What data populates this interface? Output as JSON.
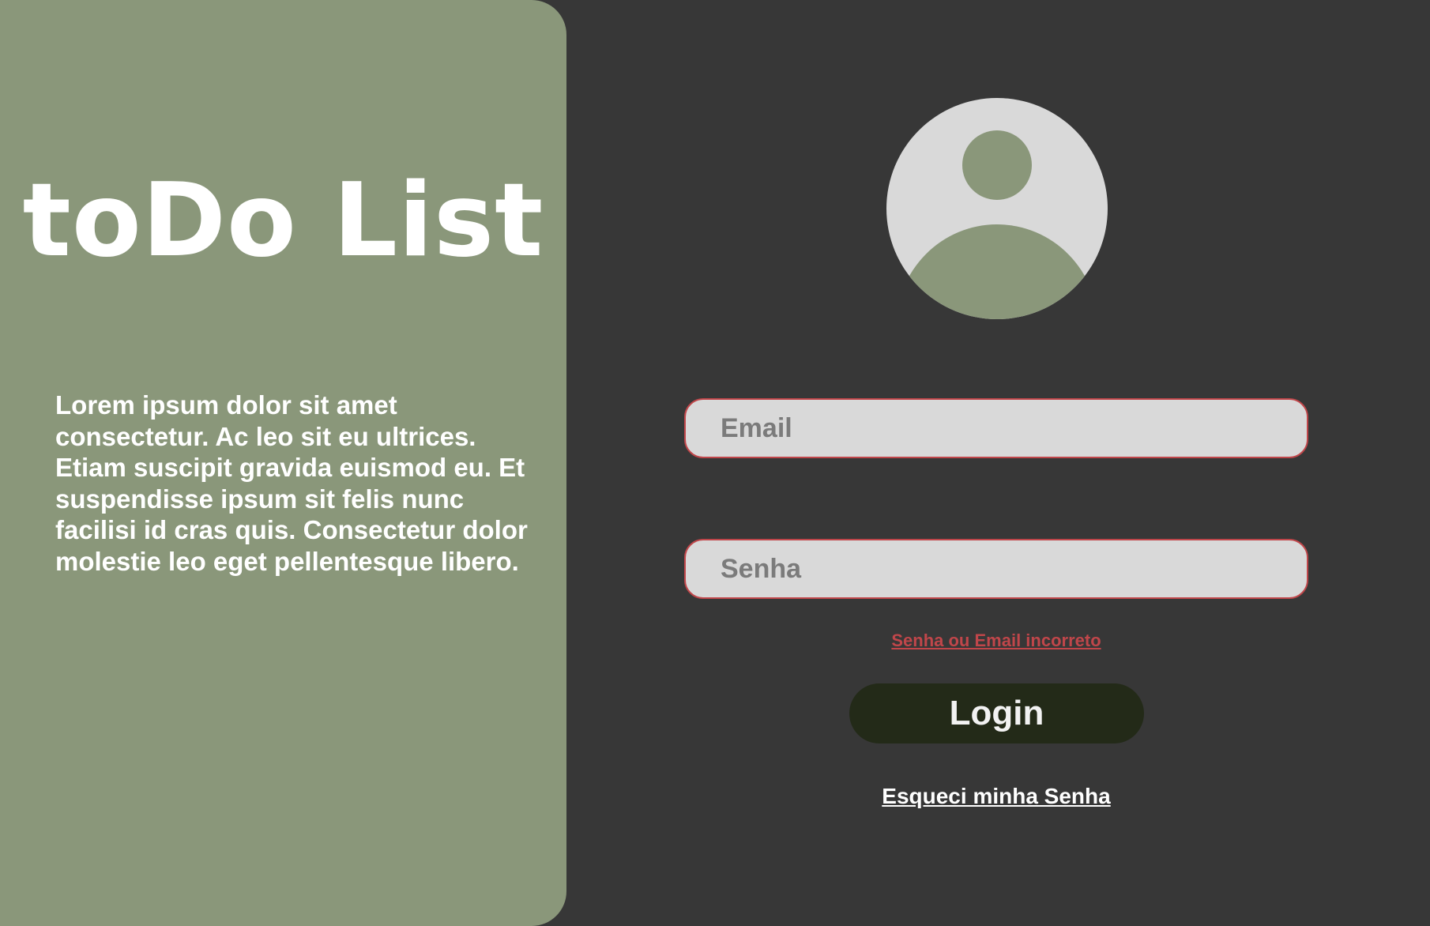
{
  "left_panel": {
    "title": "toDo List",
    "description": "Lorem ipsum dolor sit amet consectetur. Ac leo sit eu ultrices. Etiam suscipit gravida euismod eu. Et suspendisse ipsum sit felis nunc facilisi id cras quis. Consectetur dolor molestie leo eget pellentesque libero."
  },
  "login_form": {
    "avatar_icon": "user-icon",
    "email": {
      "placeholder": "Email",
      "value": ""
    },
    "password": {
      "placeholder": "Senha",
      "value": ""
    },
    "error_message": "Senha ou Email incorreto",
    "login_label": "Login",
    "forgot_password_label": "Esqueci minha Senha"
  },
  "colors": {
    "background": "#373737",
    "panel": "#8a977a",
    "field_background": "#d9d9d9",
    "error": "#c0464a",
    "button": "#232a18",
    "text_light": "#ffffff"
  }
}
